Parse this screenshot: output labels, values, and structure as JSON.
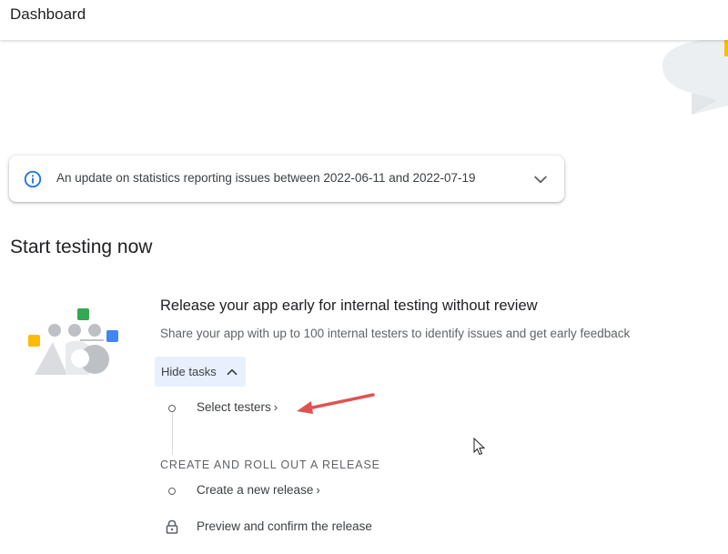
{
  "header": {
    "title": "Dashboard"
  },
  "banner": {
    "icon": "info-icon",
    "text": "An update on statistics reporting issues between 2022-06-11 and 2022-07-19",
    "expand_icon": "chevron-down-icon"
  },
  "section": {
    "title": "Start testing now",
    "card": {
      "title": "Release your app early for internal testing without review",
      "description": "Share your app with up to 100 internal testers to identify issues and get early feedback",
      "toggle_label": "Hide tasks",
      "toggle_icon": "chevron-up-icon",
      "tasks": [
        {
          "label": "Select testers",
          "chevron": "›",
          "status": "pending"
        }
      ],
      "subsection_title": "CREATE AND ROLL OUT A RELEASE",
      "subtasks": [
        {
          "label": "Create a new release",
          "chevron": "›",
          "status": "pending"
        },
        {
          "label": "Preview and confirm the release",
          "status": "locked"
        }
      ]
    }
  },
  "colors": {
    "accent_bg": "#e8f0fe",
    "text_primary": "#202124",
    "text_secondary": "#5f6368",
    "annotation_arrow": "#e05252",
    "illus_yellow": "#fbbc04",
    "illus_green": "#34a853",
    "illus_blue": "#4285f4",
    "illus_grey": "#dadce0"
  }
}
